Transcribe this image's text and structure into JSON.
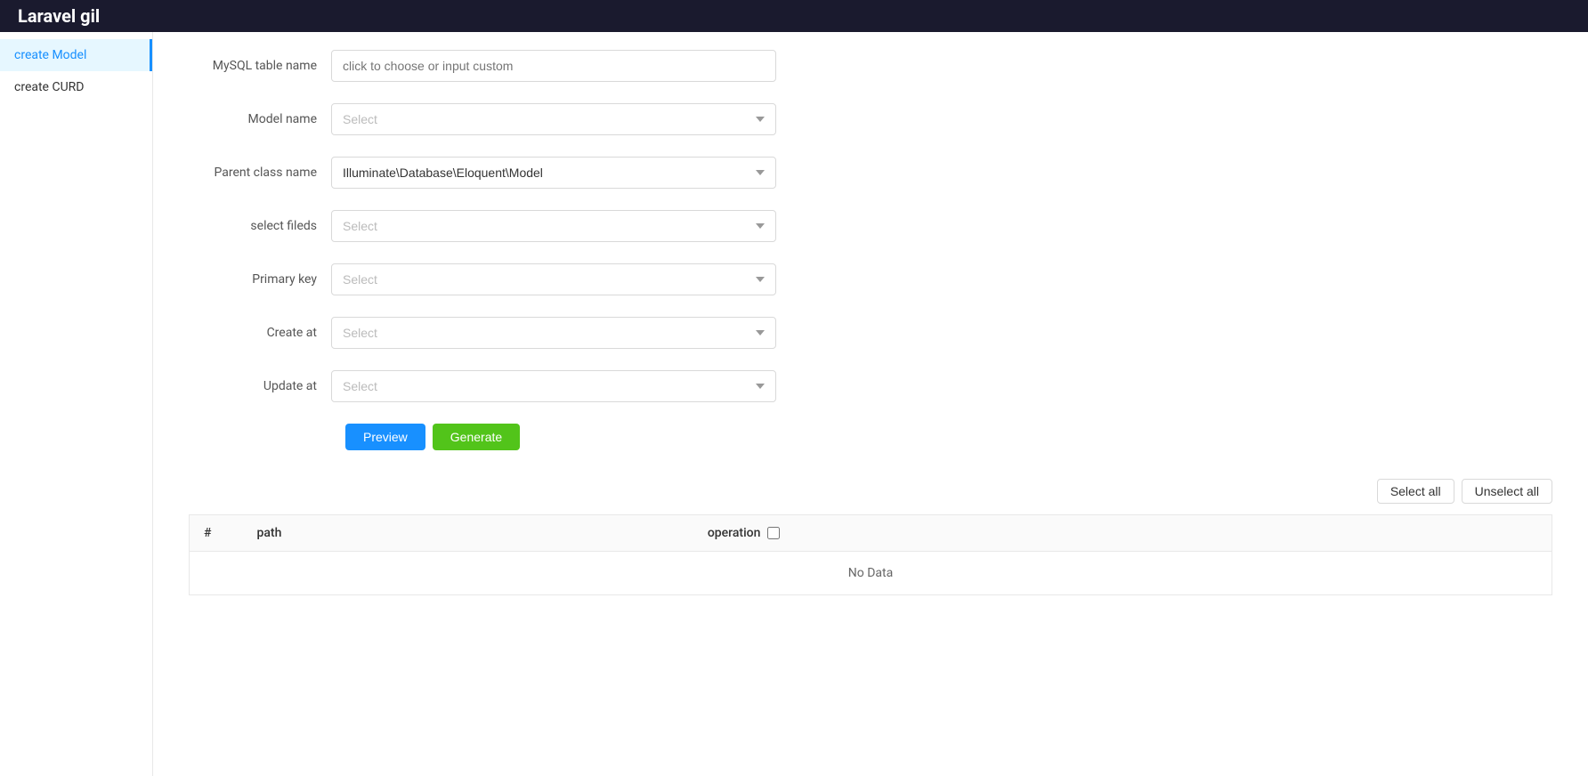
{
  "header": {
    "title": "Laravel gil"
  },
  "sidebar": {
    "items": [
      {
        "id": "create-model",
        "label": "create Model",
        "active": true
      },
      {
        "id": "create-curd",
        "label": "create CURD",
        "active": false
      }
    ]
  },
  "form": {
    "mysql_table_name": {
      "label": "MySQL table name",
      "placeholder": "click to choose or input custom",
      "value": ""
    },
    "model_name": {
      "label": "Model name",
      "placeholder": "Select",
      "value": ""
    },
    "parent_class_name": {
      "label": "Parent class name",
      "placeholder": "Illuminate\\Database\\Eloquent\\Model",
      "value": "Illuminate\\Database\\Eloquent\\Model"
    },
    "select_fields": {
      "label": "select fileds",
      "placeholder": "Select",
      "value": ""
    },
    "primary_key": {
      "label": "Primary key",
      "placeholder": "Select",
      "value": ""
    },
    "create_at": {
      "label": "Create at",
      "placeholder": "Select",
      "value": ""
    },
    "update_at": {
      "label": "Update at",
      "placeholder": "Select",
      "value": ""
    },
    "buttons": {
      "preview": "Preview",
      "generate": "Generate"
    }
  },
  "table": {
    "select_all_label": "Select all",
    "unselect_all_label": "Unselect all",
    "columns": {
      "hash": "#",
      "path": "path",
      "operation": "operation"
    },
    "no_data": "No Data",
    "rows": []
  }
}
